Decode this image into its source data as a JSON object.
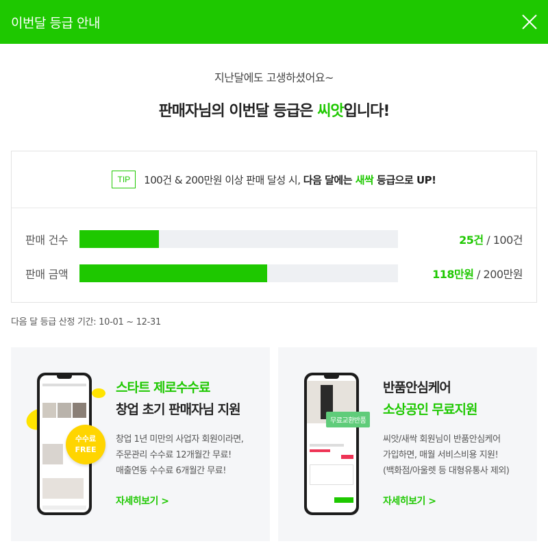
{
  "header": {
    "title": "이번달 등급 안내",
    "close_icon": "close-icon"
  },
  "intro": {
    "sub": "지난달에도 고생하셨어요~",
    "main_prefix": "판매자님의 이번달 등급은 ",
    "grade": "씨앗",
    "main_suffix": "입니다!"
  },
  "tip": {
    "badge": "TIP",
    "text_prefix": "100건 & 200만원 이상 판매 달성 시, ",
    "bold_prefix": "다음 달에는 ",
    "next_grade": "새싹",
    "bold_suffix": " 등급으로 UP!"
  },
  "stats": [
    {
      "label": "판매 건수",
      "current": "25건",
      "target": "/ 100건",
      "progress": 0.25
    },
    {
      "label": "판매 금액",
      "current": "118만원",
      "target": "/ 200만원",
      "progress": 0.59
    }
  ],
  "period": "다음 달 등급 산정 기간: 10-01 ~ 12-31",
  "cards": [
    {
      "title_line1": "스타트 제로수수료",
      "title_line2": "창업 초기 판매자님 지원",
      "desc": [
        "창업 1년 미만의 사업자 회원이라면,",
        "주문관리 수수료 12개월간 무료!",
        "매출연동 수수료 6개월간 무료!"
      ],
      "badge_line1": "수수료",
      "badge_line2": "FREE",
      "link": "자세히보기 >"
    },
    {
      "title_line1": "반품안심케어",
      "title_line2": "소상공인 무료지원",
      "desc": [
        "씨앗/새싹 회원님이 반품안심케어",
        "가입하면, 매월 서비스비용 지원!",
        "(백화점/아울렛 등 대형유통사 제외)"
      ],
      "tag": "무료교환반품",
      "link": "자세히보기 >"
    }
  ],
  "colors": {
    "brand": "#1ec800",
    "track": "#eef0f3"
  }
}
